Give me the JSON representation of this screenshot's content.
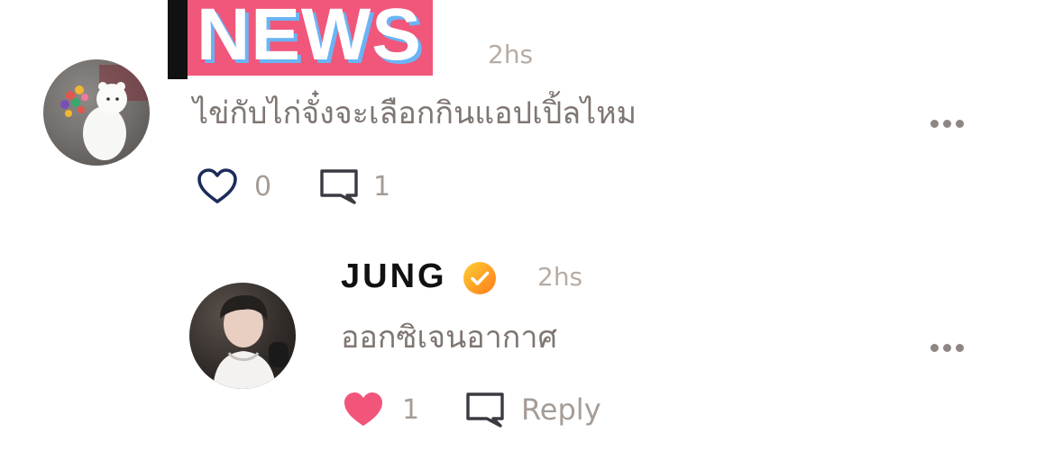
{
  "main_comment": {
    "badge_text": "NEWS",
    "time": "2hs",
    "text": "ไข่กับไก่จั๋งจะเลือกกินแอปเปิ้ลไหม",
    "like_count": "0",
    "comment_count": "1",
    "liked": false
  },
  "reply": {
    "username": "JUNG",
    "verified": true,
    "time": "2hs",
    "text": "ออกซิเจนอากาศ",
    "like_count": "1",
    "reply_label": "Reply",
    "liked": true
  },
  "colors": {
    "liked_heart": "#f2557a",
    "outline_heart": "#1d2b5a",
    "badge_bg": "#f0577a",
    "badge_shadow": "#6ab4f5",
    "verified_gradient_start": "#ffcf33",
    "verified_gradient_end": "#ff7a1a",
    "muted_text": "#b7aca3"
  },
  "icons": {
    "more": "more-horizontal-icon",
    "like_outline": "heart-outline-icon",
    "like_filled": "heart-filled-icon",
    "comment": "comment-bubble-icon",
    "verified": "verified-badge-icon"
  }
}
